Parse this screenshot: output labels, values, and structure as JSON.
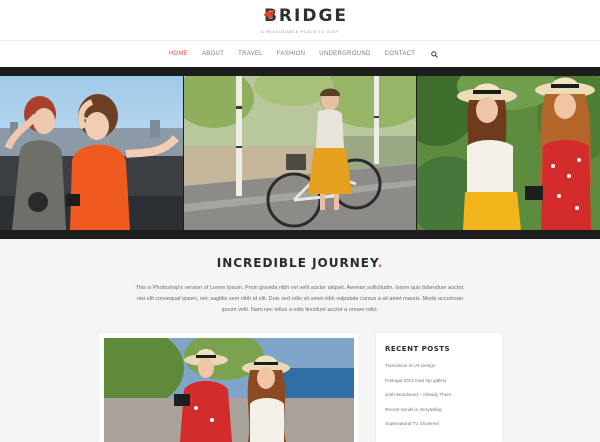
{
  "brand": {
    "name": "BRIDGE",
    "tagline": "A REASONABLE PLACE TO STAY",
    "accent": "#e0534a"
  },
  "nav": {
    "items": [
      {
        "label": "HOME",
        "active": true
      },
      {
        "label": "ABOUT",
        "active": false
      },
      {
        "label": "TRAVEL",
        "active": false
      },
      {
        "label": "FASHION",
        "active": false
      },
      {
        "label": "UNDERGROUND",
        "active": false
      },
      {
        "label": "CONTACT",
        "active": false
      }
    ],
    "search_icon": "search-icon"
  },
  "hero": {
    "panels": [
      "photo-two-women-hand-glasses",
      "photo-woman-with-bicycle",
      "photo-two-women-straw-hats"
    ]
  },
  "intro": {
    "title": "INCREDIBLE JOURNEY",
    "title_dot": ".",
    "body": "This is Photoshop's version of Lorem Ipsum. Proin gravida nibh vel velit auctor aliquet. Aenean sollicitudin, lorem quis bibendum auctor, nisi elit consequat ipsum, nec sagittis sem nibh id elit. Duis sed odio sit amet nibh vulputate cursus a sit amet mauris. Morbi accumsan ipsum velit. Nam nec tellus a odio tincidunt auctor a ornare odio."
  },
  "recent_posts": {
    "title": "RECENT POSTS",
    "items": [
      "Transitions in UX Design",
      "Portugal 2013 road trip gallery",
      "Josh Woodward – Already There",
      "Recent trends in storytelling",
      "Supernatural TV Showreel"
    ]
  }
}
